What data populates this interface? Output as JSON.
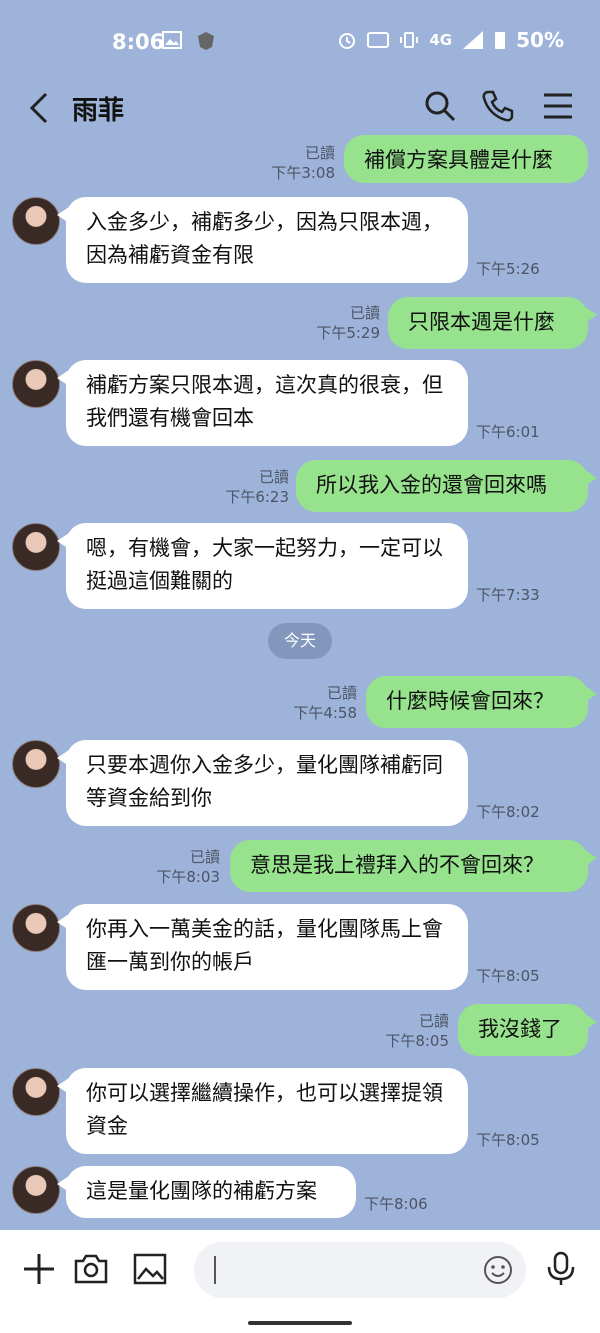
{
  "status_bar": {
    "time": "8:06",
    "network": "4G",
    "battery": "50%",
    "icons": [
      "image-icon",
      "shield-icon",
      "alarm-icon",
      "auto-icon",
      "vibrate-icon",
      "signal-icon",
      "battery-icon"
    ]
  },
  "header": {
    "title": "雨菲",
    "icons": [
      "back-icon",
      "search-icon",
      "phone-icon",
      "menu-icon"
    ]
  },
  "messages": [
    {
      "side": "right",
      "text": "補償方案具體是什麼",
      "read": "已讀",
      "time": "下午3:08"
    },
    {
      "side": "left",
      "text": "入金多少，補虧多少，因為只限本週，因為補虧資金有限",
      "time": "下午5:26"
    },
    {
      "side": "right",
      "text": "只限本週是什麼",
      "read": "已讀",
      "time": "下午5:29"
    },
    {
      "side": "left",
      "text": "補虧方案只限本週，這次真的很衰，但我們還有機會回本",
      "time": "下午6:01"
    },
    {
      "side": "right",
      "text": "所以我入金的還會回來嗎",
      "read": "已讀",
      "time": "下午6:23"
    },
    {
      "side": "left",
      "text": "嗯，有機會，大家一起努力，一定可以挺過這個難關的",
      "time": "下午7:33"
    },
    {
      "side": "right",
      "text": "什麼時候會回來？",
      "read": "已讀",
      "time": "下午4:58"
    },
    {
      "side": "left",
      "text": "只要本週你入金多少，量化團隊補虧同等資金給到你",
      "time": "下午8:02"
    },
    {
      "side": "right",
      "text": "意思是我上禮拜入的不會回來？",
      "read": "已讀",
      "time": "下午8:03"
    },
    {
      "side": "left",
      "text": "你再入一萬美金的話，量化團隊馬上會匯一萬到你的帳戶",
      "time": "下午8:05"
    },
    {
      "side": "right",
      "text": "我沒錢了",
      "read": "已讀",
      "time": "下午8:05"
    },
    {
      "side": "left",
      "text": "你可以選擇繼續操作，也可以選擇提領資金",
      "time": "下午8:05"
    },
    {
      "side": "left",
      "text": "這是量化團隊的補虧方案",
      "time": "下午8:06"
    }
  ],
  "date_divider": "今天",
  "composer": {
    "icons": [
      "plus-icon",
      "camera-icon",
      "image-icon",
      "emoji-icon",
      "mic-icon"
    ],
    "placeholder": ""
  },
  "colors": {
    "background": "#9db3d9",
    "bubble_right": "#97e38d",
    "bubble_left": "#ffffff"
  }
}
